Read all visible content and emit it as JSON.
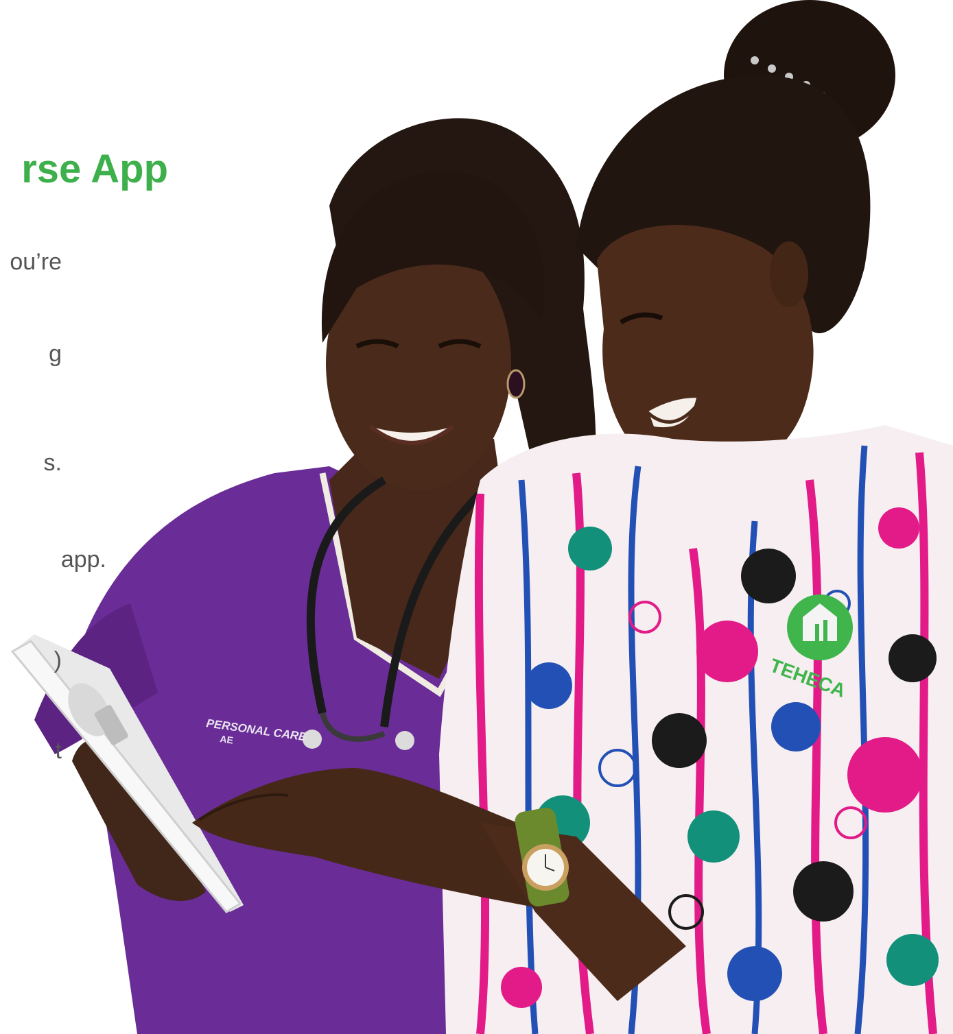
{
  "colors": {
    "heading": "#3db04b",
    "body_text": "#555555",
    "purple_scrubs": "#6a2c96",
    "skin": "#4a2a1a",
    "hair": "#221510",
    "print_pink": "#e21b88",
    "print_blue": "#2350b5",
    "print_teal": "#12907a",
    "logo_green": "#3fb54c"
  },
  "heading": {
    "text": "rse App"
  },
  "body_fragments": [
    "ou’re",
    "g",
    "s.",
    "app.",
    ")",
    "t"
  ],
  "scrub_label": {
    "line1": "PERSONAL CARE",
    "line2": "AE"
  },
  "logo_text": "TEHECA",
  "icons": [
    "tablet",
    "stethoscope",
    "wristwatch",
    "teheca-logo"
  ]
}
